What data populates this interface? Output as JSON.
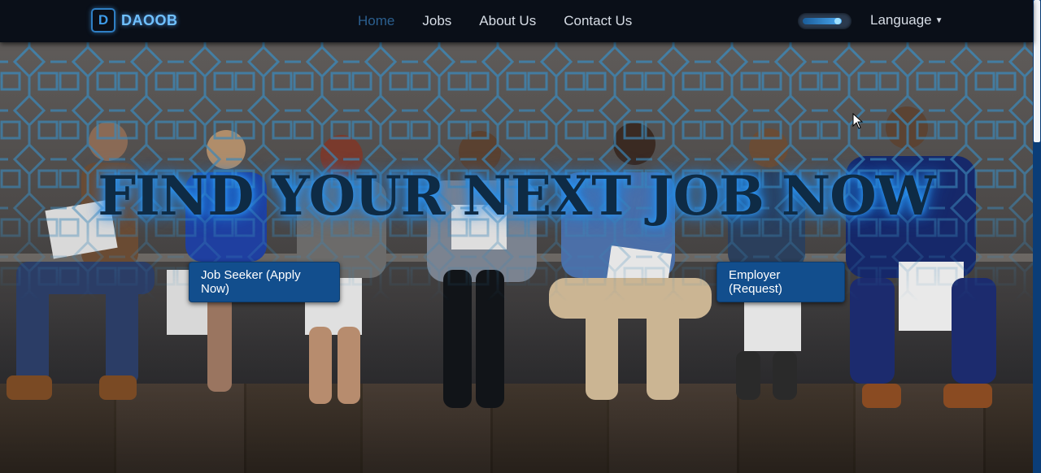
{
  "brand": {
    "logo_glyph": "D",
    "name": "DAOOB"
  },
  "nav": {
    "items": [
      {
        "label": "Home",
        "active": true
      },
      {
        "label": "Jobs",
        "active": false
      },
      {
        "label": "About Us",
        "active": false
      },
      {
        "label": "Contact Us",
        "active": false
      }
    ],
    "language_label": "Language"
  },
  "hero": {
    "headline": "FIND YOUR NEXT JOB NOW",
    "seeker_button": "Job Seeker (Apply Now)",
    "employer_button": "Employer (Request)"
  },
  "colors": {
    "navbar_bg": "#0a0f18",
    "brand_glow": "#6fc0ff",
    "active_link": "#2b5f8f",
    "cta_bg": "#124e8d",
    "headline_glow": "#2f9dff"
  },
  "icons": [
    "brand-logo-icon",
    "theme-toggle-icon",
    "caret-down-icon",
    "mouse-cursor-icon"
  ]
}
